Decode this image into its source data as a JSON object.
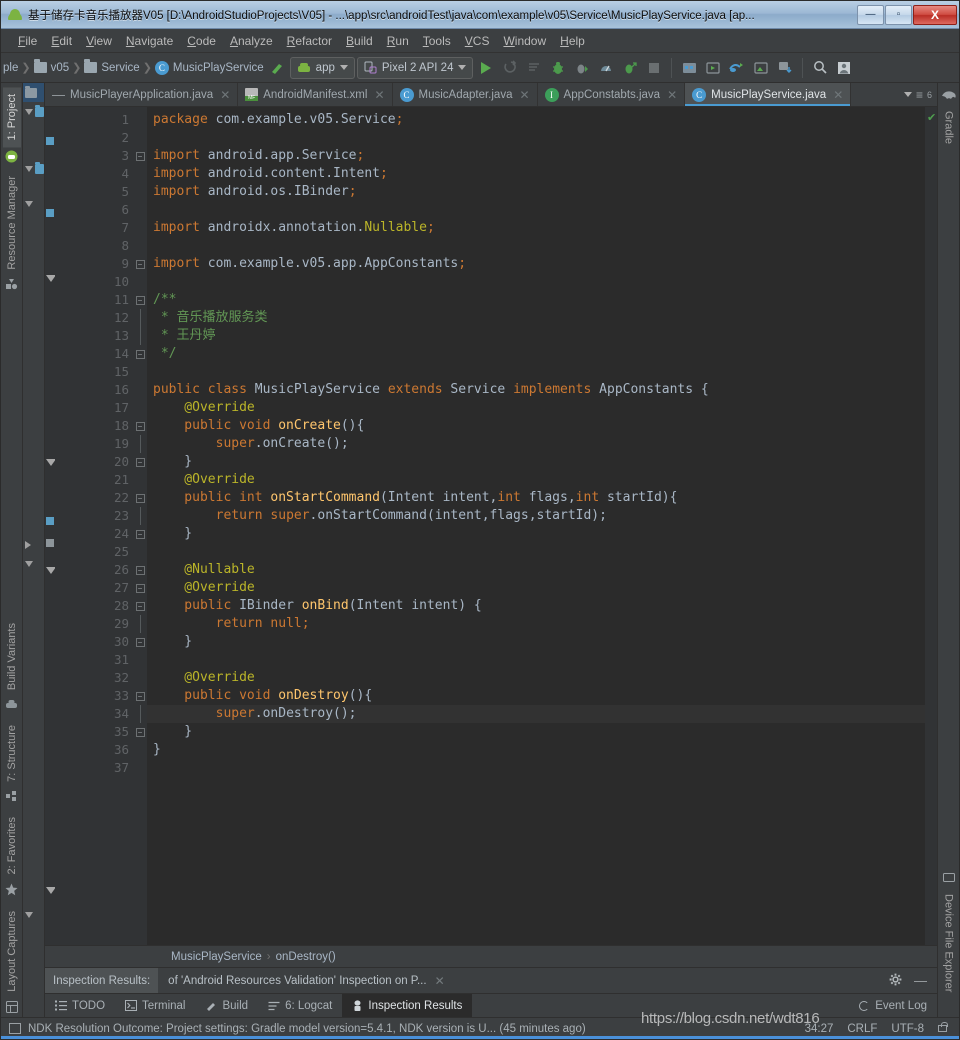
{
  "window": {
    "title": "基于储存卡音乐播放器V05 [D:\\AndroidStudioProjects\\V05] - ...\\app\\src\\androidTest\\java\\com\\example\\v05\\Service\\MusicPlayService.java [ap...",
    "icon": "android-icon",
    "minimize_label": "—",
    "maximize_label": "▫",
    "close_label": "X"
  },
  "menubar": {
    "items": [
      {
        "label": "File",
        "first": "F",
        "rest": "ile"
      },
      {
        "label": "Edit",
        "first": "E",
        "rest": "dit"
      },
      {
        "label": "View",
        "first": "V",
        "rest": "iew"
      },
      {
        "label": "Navigate",
        "first": "N",
        "rest": "avigate"
      },
      {
        "label": "Code",
        "first": "C",
        "rest": "ode"
      },
      {
        "label": "Analyze",
        "first": "A",
        "rest": "nalyze"
      },
      {
        "label": "Refactor",
        "first": "R",
        "rest": "efactor"
      },
      {
        "label": "Build",
        "first": "B",
        "rest": "uild"
      },
      {
        "label": "Run",
        "first": "R",
        "rest": "un"
      },
      {
        "label": "Tools",
        "first": "T",
        "rest": "ools"
      },
      {
        "label": "VCS",
        "first": "V",
        "rest": "CS"
      },
      {
        "label": "Window",
        "first": "W",
        "rest": "indow"
      },
      {
        "label": "Help",
        "first": "H",
        "rest": "elp"
      }
    ]
  },
  "navbar": {
    "breadcrumbs": [
      {
        "label": "ple",
        "icon": "folder-icon"
      },
      {
        "label": "v05",
        "icon": "folder-icon"
      },
      {
        "label": "Service",
        "icon": "folder-icon"
      },
      {
        "label": "MusicPlayService",
        "icon": "class-icon"
      }
    ],
    "build_icon": "hammer-icon",
    "module_selector": {
      "label": "app",
      "icon": "android-icon"
    },
    "device_selector": {
      "label": "Pixel 2 API 24",
      "icon": "device-icon"
    },
    "actions": [
      {
        "name": "run-button",
        "icon": "play-icon"
      },
      {
        "name": "apply-changes-button",
        "icon": "apply-changes-icon"
      },
      {
        "name": "apply-code-changes-button",
        "icon": "apply-code-icon"
      },
      {
        "name": "debug-button",
        "icon": "bug-icon"
      },
      {
        "name": "attach-debugger-button",
        "icon": "attach-debug-icon"
      },
      {
        "name": "profiler-button",
        "icon": "profiler-icon"
      },
      {
        "name": "run-with-coverage-button",
        "icon": "coverage-icon"
      },
      {
        "name": "stop-button",
        "icon": "stop-icon"
      },
      {
        "name": "sdk-manager-button",
        "icon": "sdk-manager-icon"
      },
      {
        "name": "avd-manager-button",
        "icon": "avd-manager-icon"
      },
      {
        "name": "sync-gradle-button",
        "icon": "gradle-sync-icon"
      },
      {
        "name": "layout-inspector-button",
        "icon": "layout-inspector-icon"
      },
      {
        "name": "device-manager-button",
        "icon": "device-download-icon"
      },
      {
        "name": "search-everywhere-button",
        "icon": "search-icon"
      },
      {
        "name": "profile-button",
        "icon": "user-icon"
      }
    ]
  },
  "tabs": [
    {
      "label": "MusicPlayerApplication.java",
      "icon": "java-class-icon",
      "active": false,
      "close": "✕"
    },
    {
      "label": "AndroidManifest.xml",
      "icon": "manifest-icon",
      "active": false,
      "close": "✕"
    },
    {
      "label": "MusicAdapter.java",
      "icon": "java-class-icon",
      "active": false,
      "close": "✕"
    },
    {
      "label": "AppConstabts.java",
      "icon": "java-interface-icon",
      "active": false,
      "close": "✕"
    },
    {
      "label": "MusicPlayService.java",
      "icon": "java-class-icon",
      "active": true,
      "close": "✕"
    }
  ],
  "tab_right": {
    "count": "6",
    "menu_icon": "tab-list-icon",
    "gradle_icon": "gradle-elephant-icon"
  },
  "left_stripe": [
    {
      "label": "1: Project",
      "icon": "android-icon",
      "active": true
    },
    {
      "label": "Resource Manager",
      "icon": "resource-icon",
      "active": false
    },
    {
      "label": "Build Variants",
      "icon": "variants-icon",
      "active": false
    },
    {
      "label": "7: Structure",
      "icon": "structure-icon",
      "active": false
    },
    {
      "label": "2: Favorites",
      "icon": "star-icon",
      "active": false
    },
    {
      "label": "Layout Captures",
      "icon": "layout-capture-icon",
      "active": false
    }
  ],
  "right_stripe": [
    {
      "label": "Gradle",
      "icon": "gradle-elephant-icon"
    },
    {
      "label": "Device File Explorer",
      "icon": "device-file-icon"
    }
  ],
  "editor": {
    "first_line": 1,
    "current_line": 34,
    "lines": [
      {
        "n": 1,
        "tokens": [
          {
            "t": "package",
            "c": "kw"
          },
          {
            "t": " com.example.v05.Service",
            "c": "id"
          },
          {
            "t": ";",
            "c": "semi"
          }
        ],
        "indent": 0,
        "fold": "",
        "gicon": ""
      },
      {
        "n": 2,
        "tokens": [],
        "fold": "",
        "gicon": ""
      },
      {
        "n": 3,
        "tokens": [
          {
            "t": "import",
            "c": "kw"
          },
          {
            "t": " android.app.Service",
            "c": "id"
          },
          {
            "t": ";",
            "c": "semi"
          }
        ],
        "fold": "minus-top",
        "gicon": ""
      },
      {
        "n": 4,
        "tokens": [
          {
            "t": "import",
            "c": "kw"
          },
          {
            "t": " android.content.Intent",
            "c": "id"
          },
          {
            "t": ";",
            "c": "semi"
          }
        ],
        "fold": "",
        "gicon": ""
      },
      {
        "n": 5,
        "tokens": [
          {
            "t": "import",
            "c": "kw"
          },
          {
            "t": " android.os.IBinder",
            "c": "id"
          },
          {
            "t": ";",
            "c": "semi"
          }
        ],
        "fold": "",
        "gicon": ""
      },
      {
        "n": 6,
        "tokens": [],
        "fold": "",
        "gicon": ""
      },
      {
        "n": 7,
        "tokens": [
          {
            "t": "import",
            "c": "kw"
          },
          {
            "t": " androidx.annotation.",
            "c": "id"
          },
          {
            "t": "Nullable",
            "c": "ann"
          },
          {
            "t": ";",
            "c": "semi"
          }
        ],
        "fold": "",
        "gicon": ""
      },
      {
        "n": 8,
        "tokens": [],
        "fold": "",
        "gicon": ""
      },
      {
        "n": 9,
        "tokens": [
          {
            "t": "import",
            "c": "kw"
          },
          {
            "t": " com.example.v05.app.AppConstants",
            "c": "id"
          },
          {
            "t": ";",
            "c": "semi"
          }
        ],
        "fold": "minus-bot",
        "gicon": ""
      },
      {
        "n": 10,
        "tokens": [],
        "fold": "",
        "gicon": ""
      },
      {
        "n": 11,
        "tokens": [
          {
            "t": "/**",
            "c": "cmt"
          }
        ],
        "fold": "minus-top",
        "gicon": ""
      },
      {
        "n": 12,
        "tokens": [
          {
            "t": " * 音乐播放服务类",
            "c": "cmt"
          }
        ],
        "fold": "bar",
        "gicon": ""
      },
      {
        "n": 13,
        "tokens": [
          {
            "t": " * 王丹婷",
            "c": "cmt"
          }
        ],
        "fold": "bar",
        "gicon": ""
      },
      {
        "n": 14,
        "tokens": [
          {
            "t": " */",
            "c": "cmt"
          }
        ],
        "fold": "minus-bot",
        "gicon": ""
      },
      {
        "n": 15,
        "tokens": [],
        "fold": "",
        "gicon": ""
      },
      {
        "n": 16,
        "tokens": [
          {
            "t": "public class",
            "c": "kw"
          },
          {
            "t": " MusicPlayService ",
            "c": "cls"
          },
          {
            "t": "extends",
            "c": "kw"
          },
          {
            "t": " Service ",
            "c": "cls"
          },
          {
            "t": "implements",
            "c": "kw"
          },
          {
            "t": " AppConstants {",
            "c": "cls"
          }
        ],
        "fold": "",
        "gicon": ""
      },
      {
        "n": 17,
        "tokens": [
          {
            "t": "    @Override",
            "c": "ann"
          }
        ],
        "fold": "",
        "gicon": ""
      },
      {
        "n": 18,
        "tokens": [
          {
            "t": "    public void",
            "c": "kw"
          },
          {
            "t": " ",
            "c": "id"
          },
          {
            "t": "onCreate",
            "c": "fn"
          },
          {
            "t": "(){",
            "c": "id"
          }
        ],
        "fold": "minus-top",
        "gicon": "override-blue"
      },
      {
        "n": 19,
        "tokens": [
          {
            "t": "        ",
            "c": "id"
          },
          {
            "t": "super",
            "c": "kw"
          },
          {
            "t": ".onCreate();",
            "c": "id"
          }
        ],
        "fold": "bar",
        "gicon": ""
      },
      {
        "n": 20,
        "tokens": [
          {
            "t": "    }",
            "c": "id"
          }
        ],
        "fold": "minus-bot",
        "gicon": ""
      },
      {
        "n": 21,
        "tokens": [
          {
            "t": "    @Override",
            "c": "ann"
          }
        ],
        "fold": "",
        "gicon": ""
      },
      {
        "n": 22,
        "tokens": [
          {
            "t": "    public int",
            "c": "kw"
          },
          {
            "t": " ",
            "c": "id"
          },
          {
            "t": "onStartCommand",
            "c": "fn"
          },
          {
            "t": "(Intent intent,",
            "c": "id"
          },
          {
            "t": "int",
            "c": "kw"
          },
          {
            "t": " flags,",
            "c": "id"
          },
          {
            "t": "int",
            "c": "kw"
          },
          {
            "t": " startId){",
            "c": "id"
          }
        ],
        "fold": "minus-top",
        "gicon": "override-blue"
      },
      {
        "n": 23,
        "tokens": [
          {
            "t": "        ",
            "c": "id"
          },
          {
            "t": "return super",
            "c": "kw"
          },
          {
            "t": ".onStartCommand(intent,flags,startId);",
            "c": "id"
          }
        ],
        "fold": "bar",
        "gicon": ""
      },
      {
        "n": 24,
        "tokens": [
          {
            "t": "    }",
            "c": "id"
          }
        ],
        "fold": "minus-bot",
        "gicon": ""
      },
      {
        "n": 25,
        "tokens": [],
        "fold": "",
        "gicon": ""
      },
      {
        "n": 26,
        "tokens": [
          {
            "t": "    @Nullable",
            "c": "ann"
          }
        ],
        "fold": "minus-top",
        "gicon": ""
      },
      {
        "n": 27,
        "tokens": [
          {
            "t": "    @Override",
            "c": "ann"
          }
        ],
        "fold": "minus-bot",
        "gicon": ""
      },
      {
        "n": 28,
        "tokens": [
          {
            "t": "    public",
            "c": "kw"
          },
          {
            "t": " IBinder ",
            "c": "cls"
          },
          {
            "t": "onBind",
            "c": "fn"
          },
          {
            "t": "(Intent intent) {",
            "c": "id"
          }
        ],
        "fold": "minus-top",
        "gicon": "override-green"
      },
      {
        "n": 29,
        "tokens": [
          {
            "t": "        ",
            "c": "id"
          },
          {
            "t": "return null",
            "c": "kw"
          },
          {
            "t": ";",
            "c": "semi"
          }
        ],
        "fold": "bar",
        "gicon": ""
      },
      {
        "n": 30,
        "tokens": [
          {
            "t": "    }",
            "c": "id"
          }
        ],
        "fold": "minus-bot",
        "gicon": ""
      },
      {
        "n": 31,
        "tokens": [],
        "fold": "",
        "gicon": ""
      },
      {
        "n": 32,
        "tokens": [
          {
            "t": "    @Override",
            "c": "ann"
          }
        ],
        "fold": "",
        "gicon": ""
      },
      {
        "n": 33,
        "tokens": [
          {
            "t": "    public void",
            "c": "kw"
          },
          {
            "t": " ",
            "c": "id"
          },
          {
            "t": "onDestroy",
            "c": "fn"
          },
          {
            "t": "(){",
            "c": "id"
          }
        ],
        "fold": "minus-top",
        "gicon": "override-blue"
      },
      {
        "n": 34,
        "tokens": [
          {
            "t": "        ",
            "c": "id"
          },
          {
            "t": "super",
            "c": "kw"
          },
          {
            "t": ".onDestroy();",
            "c": "id"
          }
        ],
        "fold": "bar",
        "gicon": ""
      },
      {
        "n": 35,
        "tokens": [
          {
            "t": "    }",
            "c": "id"
          }
        ],
        "fold": "minus-bot",
        "gicon": ""
      },
      {
        "n": 36,
        "tokens": [
          {
            "t": "}",
            "c": "id"
          }
        ],
        "fold": "",
        "gicon": ""
      },
      {
        "n": 37,
        "tokens": [],
        "fold": "",
        "gicon": ""
      }
    ]
  },
  "breadcrumb": {
    "class": "MusicPlayService",
    "separator": "›",
    "method": "onDestroy()"
  },
  "inspection": {
    "label": "Inspection Results:",
    "title": "of 'Android Resources Validation' Inspection on P...",
    "close": "✕",
    "settings_icon": "gear-icon",
    "minimize_icon": "minimize-icon"
  },
  "bottom_tabs": [
    {
      "label": "TODO",
      "icon": "todo-icon",
      "active": false,
      "mnemonic": ""
    },
    {
      "label": "Terminal",
      "icon": "terminal-icon",
      "active": false,
      "mnemonic": ""
    },
    {
      "label": "Build",
      "icon": "hammer-icon",
      "active": false,
      "mnemonic": ""
    },
    {
      "label": "6: Logcat",
      "icon": "logcat-icon",
      "active": false,
      "mnemonic": "6"
    },
    {
      "label": "Inspection Results",
      "icon": "inspection-icon",
      "active": true,
      "mnemonic": ""
    }
  ],
  "event_log": {
    "label": "Event Log",
    "icon": "event-log-icon"
  },
  "statusbar": {
    "icon": "memory-icon",
    "message": "NDK Resolution Outcome: Project settings: Gradle model version=5.4.1, NDK version is U... (45 minutes ago)",
    "caret_position": "34:27",
    "line_separator": "CRLF",
    "encoding": "UTF-8",
    "lock_icon": "lock-icon"
  },
  "watermark": "https://blog.csdn.net/wdt816",
  "colors": {
    "accent": "#4a9bd1",
    "editor_bg": "#2b2b2b",
    "chrome_bg": "#3c3f41",
    "keyword": "#cc7832",
    "comment": "#629755",
    "annotation": "#bbb529",
    "method": "#ffc66d",
    "identifier": "#a9b7c6",
    "titlebar": "#9cb8d4"
  }
}
